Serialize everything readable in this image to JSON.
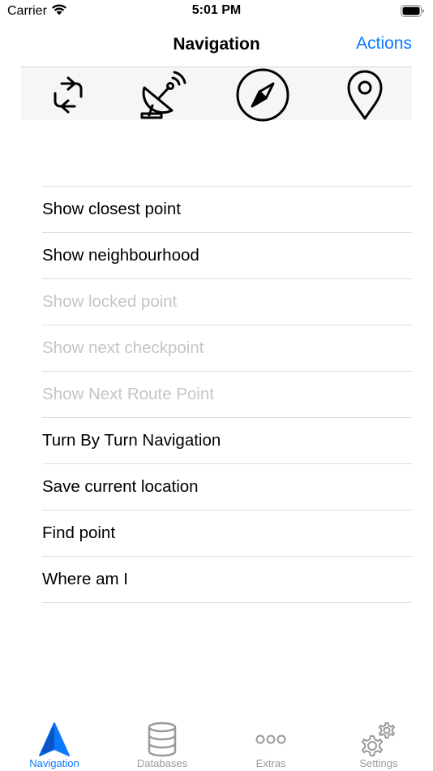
{
  "status_bar": {
    "carrier": "Carrier",
    "time": "5:01 PM"
  },
  "nav_bar": {
    "title": "Navigation",
    "action_label": "Actions"
  },
  "toolbar": {
    "buttons": [
      {
        "icon": "refresh-icon"
      },
      {
        "icon": "satellite-dish-icon"
      },
      {
        "icon": "compass-icon"
      },
      {
        "icon": "location-pin-icon"
      }
    ]
  },
  "menu": {
    "items": [
      {
        "label": "Show closest point",
        "enabled": true
      },
      {
        "label": "Show neighbourhood",
        "enabled": true
      },
      {
        "label": "Show locked point",
        "enabled": false
      },
      {
        "label": "Show next checkpoint",
        "enabled": false
      },
      {
        "label": "Show Next Route Point",
        "enabled": false
      },
      {
        "label": "Turn By Turn Navigation",
        "enabled": true
      },
      {
        "label": "Save current location",
        "enabled": true
      },
      {
        "label": "Find point",
        "enabled": true
      },
      {
        "label": "Where am I",
        "enabled": true
      }
    ]
  },
  "tab_bar": {
    "tabs": [
      {
        "label": "Navigation",
        "icon": "navigation-arrow-icon",
        "active": true
      },
      {
        "label": "Databases",
        "icon": "database-icon",
        "active": false
      },
      {
        "label": "Extras",
        "icon": "ellipsis-icon",
        "active": false
      },
      {
        "label": "Settings",
        "icon": "gears-icon",
        "active": false
      }
    ]
  },
  "colors": {
    "accent": "#0a7aff",
    "disabled_text": "#c5c5c7",
    "toolbar_bg": "#f6f6f6",
    "inactive_tab": "#9a9a9a"
  }
}
